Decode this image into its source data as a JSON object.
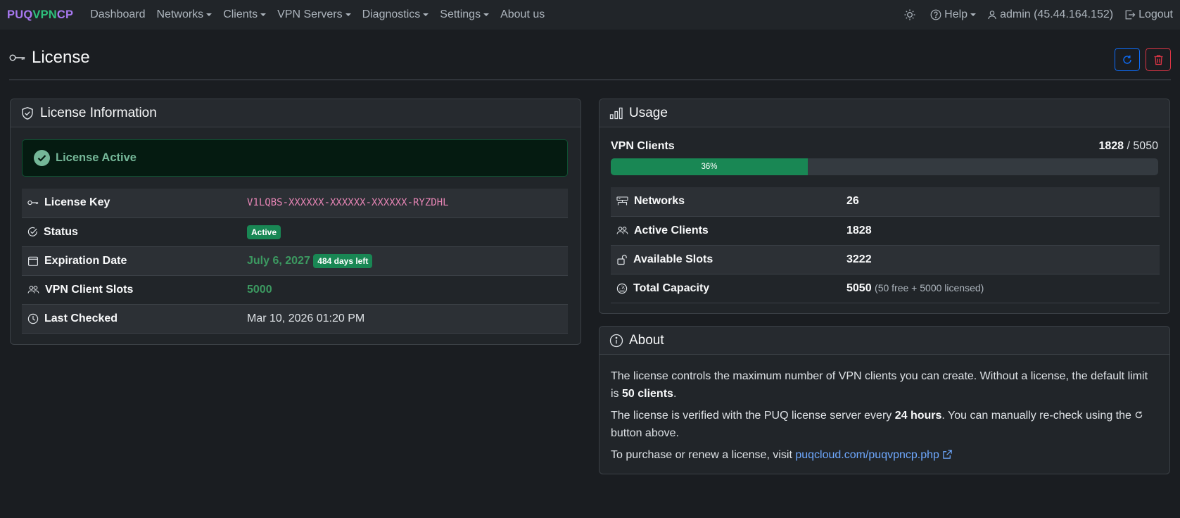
{
  "nav": {
    "brand": {
      "p1": "PUQ",
      "p2": "VPN",
      "p3": "CP"
    },
    "items": [
      {
        "label": "Dashboard",
        "dropdown": false
      },
      {
        "label": "Networks",
        "dropdown": true
      },
      {
        "label": "Clients",
        "dropdown": true
      },
      {
        "label": "VPN Servers",
        "dropdown": true
      },
      {
        "label": "Diagnostics",
        "dropdown": true
      },
      {
        "label": "Settings",
        "dropdown": true
      },
      {
        "label": "About us",
        "dropdown": false
      }
    ],
    "help": "Help",
    "user": "admin (45.44.164.152)",
    "logout": "Logout"
  },
  "page": {
    "title": "License"
  },
  "license_card": {
    "title": "License Information",
    "alert": "License Active",
    "rows": {
      "key_label": "License Key",
      "key_value": "V1LQBS-XXXXXX-XXXXXX-XXXXXX-RYZDHL",
      "status_label": "Status",
      "status_value": "Active",
      "expiration_label": "Expiration Date",
      "expiration_value": "July 6, 2027",
      "expiration_badge": "484 days left",
      "slots_label": "VPN Client Slots",
      "slots_value": "5000",
      "checked_label": "Last Checked",
      "checked_value": "Mar 10, 2026 01:20 PM"
    }
  },
  "usage_card": {
    "title": "Usage",
    "clients_label": "VPN Clients",
    "clients_used": "1828",
    "clients_sep": " / ",
    "clients_total": "5050",
    "progress_percent": 36,
    "progress_label": "36%",
    "rows": {
      "networks_label": "Networks",
      "networks_value": "26",
      "active_label": "Active Clients",
      "active_value": "1828",
      "available_label": "Available Slots",
      "available_value": "3222",
      "capacity_label": "Total Capacity",
      "capacity_value": "5050",
      "capacity_note": "(50 free + 5000 licensed)"
    }
  },
  "about_card": {
    "title": "About",
    "p1_a": "The license controls the maximum number of VPN clients you can create. Without a license, the default limit is ",
    "p1_b": "50 clients",
    "p1_c": ".",
    "p2_a": "The license is verified with the PUQ license server every ",
    "p2_b": "24 hours",
    "p2_c": ". You can manually re-check using the ",
    "p2_d": " button above.",
    "p3_a": "To purchase or renew a license, visit ",
    "p3_link": "puqcloud.com/puqvpncp.php"
  },
  "colors": {
    "accent": "#0d6efd",
    "danger": "#dc3545",
    "success": "#198754",
    "brand_purple": "#a778f0",
    "brand_green": "#2ec07c"
  }
}
